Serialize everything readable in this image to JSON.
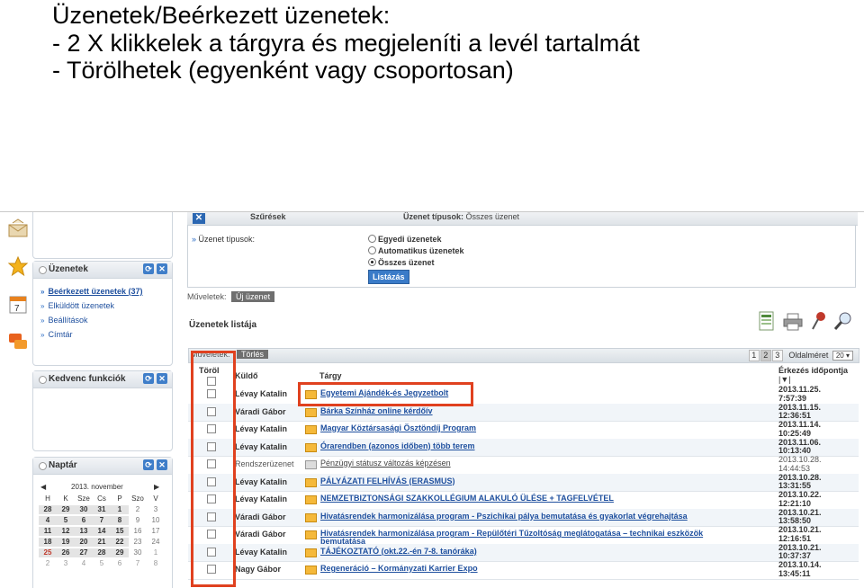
{
  "caption": {
    "line1": "Üzenetek/Beérkezett üzenetek:",
    "line2": "- 2 X klikkelek a tárgyra és megjeleníti a levél tartalmát",
    "line3": "- Törölhetek (egyenként vagy csoportosan)"
  },
  "left": {
    "messages_panel": {
      "title": "Üzenetek",
      "links": [
        "Beérkezett üzenetek (37)",
        "Elküldött üzenetek",
        "Beállítások",
        "Címtár"
      ]
    },
    "favorites_panel": {
      "title": "Kedvenc funkciók"
    },
    "calendar_panel": {
      "title": "Naptár",
      "month": "2013. november",
      "prev": "◀",
      "next": "▶",
      "weekdays": [
        "H",
        "K",
        "Sze",
        "Cs",
        "P",
        "Szo",
        "V"
      ],
      "days": [
        [
          "28",
          "29",
          "30",
          "31",
          "1",
          "2",
          "3"
        ],
        [
          "4",
          "5",
          "6",
          "7",
          "8",
          "9",
          "10"
        ],
        [
          "11",
          "12",
          "13",
          "14",
          "15",
          "16",
          "17"
        ],
        [
          "18",
          "19",
          "20",
          "21",
          "22",
          "23",
          "24"
        ],
        [
          "25",
          "26",
          "27",
          "28",
          "29",
          "30",
          "1"
        ],
        [
          "2",
          "3",
          "4",
          "5",
          "6",
          "7",
          "8"
        ]
      ]
    }
  },
  "filters": {
    "header": "Szűrések",
    "type_label": "Üzenet típusok:",
    "type_value": "Összes üzenet",
    "field_label": "Üzenet típusok:",
    "options": [
      "Egyedi üzenetek",
      "Automatikus üzenetek",
      "Összes üzenet"
    ],
    "list_button": "Listázás"
  },
  "operations": {
    "label": "Műveletek:",
    "new_message": "Új üzenet"
  },
  "list": {
    "title": "Üzenetek listája",
    "toolbar_label": "Műveletek:",
    "delete_button": "Törlés",
    "pages": [
      "1",
      "2",
      "3"
    ],
    "page_size_label": "Oldalméret",
    "page_size": "20",
    "columns": {
      "delete": "Töröl",
      "sender": "Küldő",
      "subject": "Tárgy",
      "date": "Érkezés időpontja",
      "sort": "|▼|"
    },
    "rows": [
      {
        "sender": "Lévay Katalin",
        "subject": "Egyetemi Ajándék-és Jegyzetbolt",
        "subject2": "",
        "date1": "2013.11.25.",
        "date2": "7:57:39"
      },
      {
        "sender": "Váradi Gábor",
        "subject": "Bárka Színház online kérdőív",
        "subject2": "",
        "date1": "2013.11.15.",
        "date2": "12:36:51"
      },
      {
        "sender": "Lévay Katalin",
        "subject": "Magyar Köztársasági Ösztöndíj Program",
        "subject2": "",
        "date1": "2013.11.14.",
        "date2": "10:25:49"
      },
      {
        "sender": "Lévay Katalin",
        "subject": "Órarendben (azonos időben) több terem",
        "subject2": "",
        "date1": "2013.11.06.",
        "date2": "10:13:40"
      },
      {
        "sender": "Rendszerüzenet",
        "subject": "Pénzügyi státusz változás képzésen",
        "subject2": "",
        "date1": "2013.10.28.",
        "date2": "14:44:53"
      },
      {
        "sender": "Lévay Katalin",
        "subject": "PÁLYÁZATI FELHÍVÁS (ERASMUS)",
        "subject2": "",
        "date1": "2013.10.28.",
        "date2": "13:31:55"
      },
      {
        "sender": "Lévay Katalin",
        "subject": "NEMZETBIZTONSÁGI SZAKKOLLÉGIUM ALAKULÓ ÜLÉSE + TAGFELVÉTEL",
        "subject2": "",
        "date1": "2013.10.22.",
        "date2": "12:21:10"
      },
      {
        "sender": "Váradi Gábor",
        "subject": "Hivatásrendek harmonizálása program - Pszichikai pálya bemutatása és gyakorlat végrehajtása",
        "subject2": "",
        "date1": "2013.10.21.",
        "date2": "13:58:50"
      },
      {
        "sender": "Váradi Gábor",
        "subject": "Hivatásrendek harmonizálása program - Repülőtéri Tűzoltóság meglátogatása – technikai eszközök",
        "subject2": "bemutatása",
        "date1": "2013.10.21.",
        "date2": "12:16:51"
      },
      {
        "sender": "Lévay Katalin",
        "subject": "TÁJÉKOZTATÓ (okt.22.-én 7-8. tanóráka)",
        "subject2": "",
        "date1": "2013.10.21.",
        "date2": "10:37:37"
      },
      {
        "sender": "Nagy Gábor",
        "subject": "Regeneráció – Kormányzati Karrier Expo",
        "subject2": "",
        "date1": "2013.10.14.",
        "date2": "13:45:11"
      }
    ]
  },
  "colors": {
    "highlight": "#e0411f",
    "link": "#1e4f9e",
    "accent": "#3a7bc8"
  }
}
